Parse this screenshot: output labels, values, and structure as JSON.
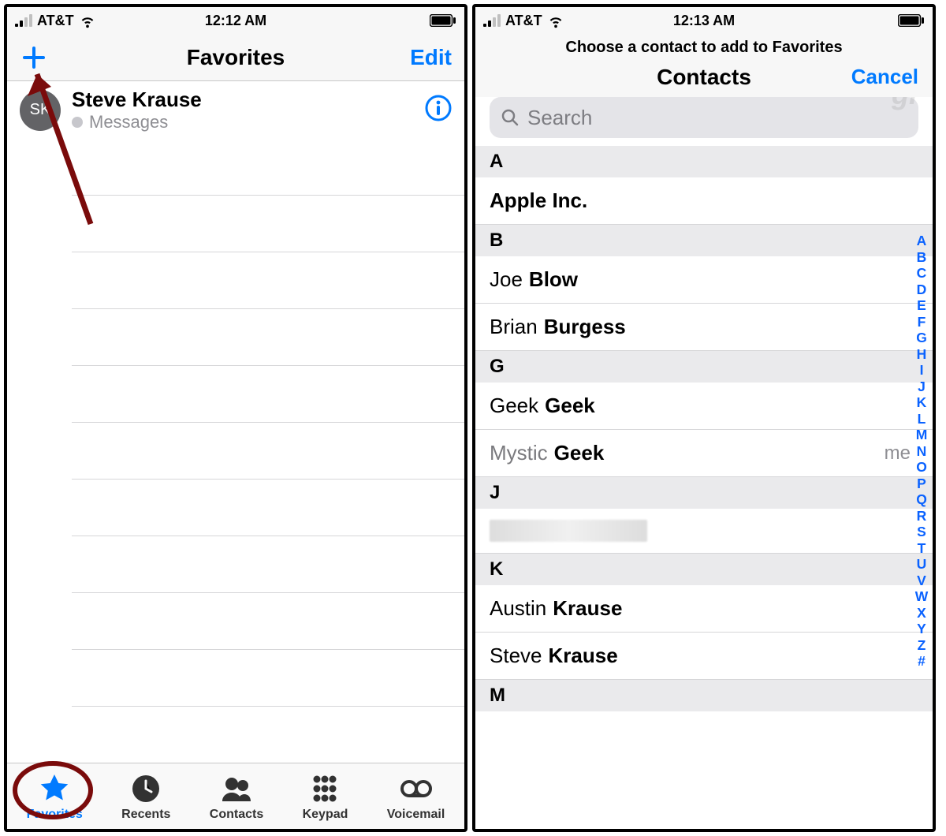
{
  "left": {
    "status": {
      "carrier": "AT&T",
      "time": "12:12 AM"
    },
    "nav": {
      "title": "Favorites",
      "edit": "Edit"
    },
    "favorite": {
      "initials": "SK",
      "name": "Steve Krause",
      "subtitle": "Messages"
    },
    "tabs": {
      "favorites": "Favorites",
      "recents": "Recents",
      "contacts": "Contacts",
      "keypad": "Keypad",
      "voicemail": "Voicemail"
    }
  },
  "right": {
    "status": {
      "carrier": "AT&T",
      "time": "12:13 AM"
    },
    "prompt": "Choose a contact to add to Favorites",
    "contacts_title": "Contacts",
    "cancel": "Cancel",
    "search_placeholder": "Search",
    "watermark": "gP",
    "sections": {
      "A": [
        {
          "first": "",
          "last": "Apple Inc."
        }
      ],
      "B": [
        {
          "first": "Joe",
          "last": "Blow"
        },
        {
          "first": "Brian",
          "last": "Burgess"
        }
      ],
      "G": [
        {
          "first": "Geek",
          "last": "Geek"
        },
        {
          "first": "Mystic",
          "last": "Geek",
          "me": "me"
        }
      ],
      "J": [
        {
          "redacted": true
        }
      ],
      "K": [
        {
          "first": "Austin",
          "last": "Krause"
        },
        {
          "first": "Steve",
          "last": "Krause"
        }
      ],
      "M": []
    },
    "index": [
      "A",
      "B",
      "C",
      "D",
      "E",
      "F",
      "G",
      "H",
      "I",
      "J",
      "K",
      "L",
      "M",
      "N",
      "O",
      "P",
      "Q",
      "R",
      "S",
      "T",
      "U",
      "V",
      "W",
      "X",
      "Y",
      "Z",
      "#"
    ]
  },
  "section_headers": {
    "A": "A",
    "B": "B",
    "G": "G",
    "J": "J",
    "K": "K",
    "M": "M"
  }
}
